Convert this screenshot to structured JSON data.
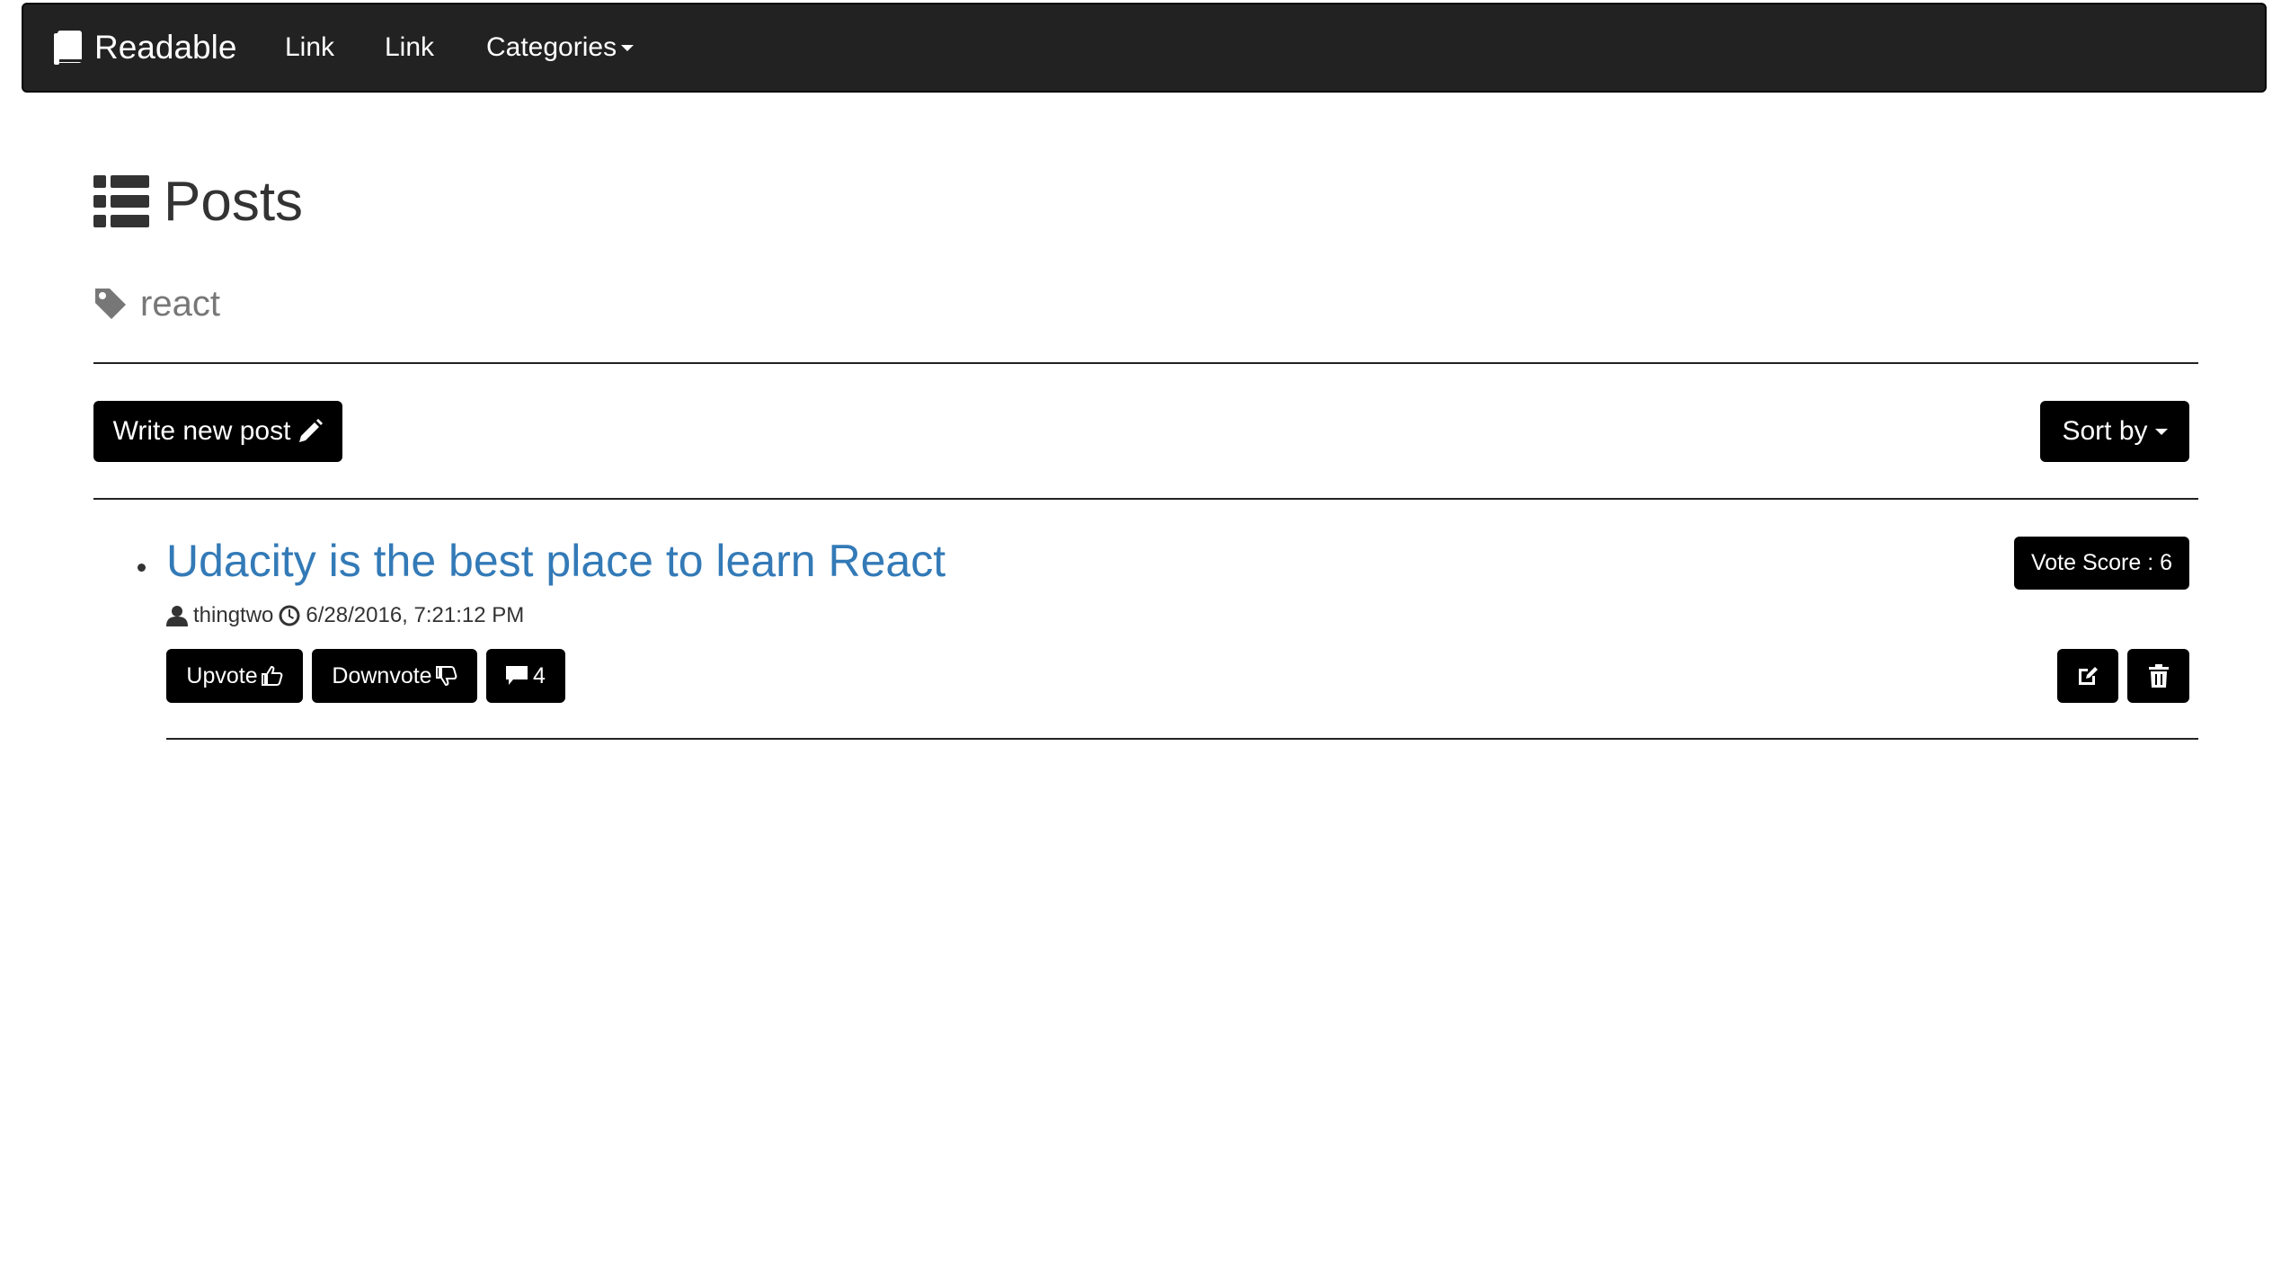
{
  "navbar": {
    "brand": "Readable",
    "links": [
      "Link",
      "Link"
    ],
    "categories_label": "Categories"
  },
  "page": {
    "title": "Posts",
    "category": "react"
  },
  "toolbar": {
    "write_post_label": "Write new post",
    "sort_label": "Sort by"
  },
  "posts": [
    {
      "title": "Udacity is the best place to learn React",
      "author": "thingtwo",
      "timestamp": "6/28/2016, 7:21:12 PM",
      "vote_score_label": "Vote Score : 6",
      "upvote_label": "Upvote",
      "downvote_label": "Downvote",
      "comment_count": "4"
    }
  ],
  "colors": {
    "navbar_bg": "#222222",
    "link_blue": "#337ab7",
    "button_bg": "#000000",
    "muted_text": "#777777"
  },
  "icons": [
    "book-icon",
    "list-icon",
    "tag-icon",
    "pencil-icon",
    "caret-down-icon",
    "user-icon",
    "clock-icon",
    "thumbs-up-icon",
    "thumbs-down-icon",
    "comment-icon",
    "edit-icon",
    "trash-icon"
  ]
}
